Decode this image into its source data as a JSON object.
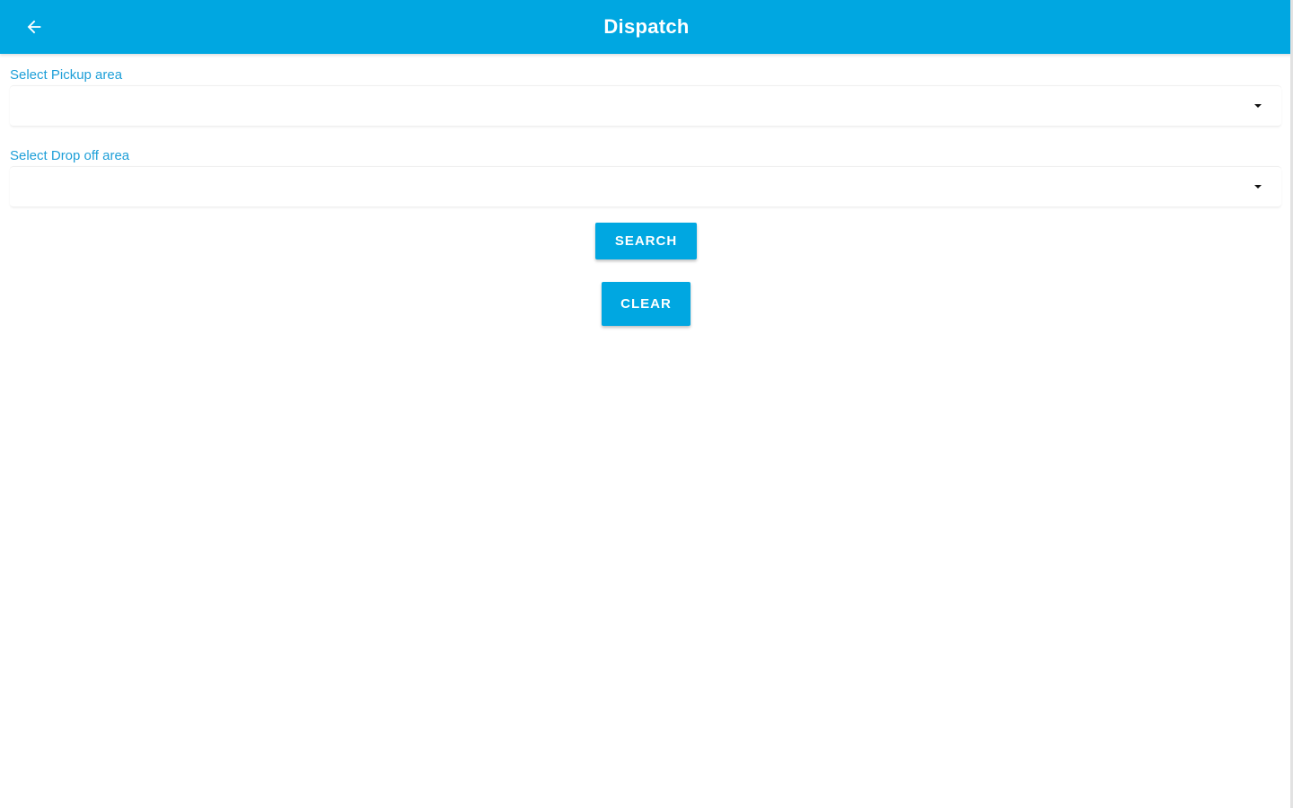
{
  "header": {
    "title": "Dispatch",
    "back_icon": "arrow-left-icon",
    "color": "#00a7e1"
  },
  "form": {
    "pickup": {
      "label": "Select Pickup area",
      "value": "",
      "icon": "caret-down-icon"
    },
    "dropoff": {
      "label": "Select Drop off area",
      "value": "",
      "icon": "caret-down-icon"
    },
    "search_label": "SEARCH",
    "clear_label": "CLEAR"
  },
  "colors": {
    "accent": "#00a7e1",
    "label": "#1e9fd8",
    "background": "#ffffff"
  }
}
